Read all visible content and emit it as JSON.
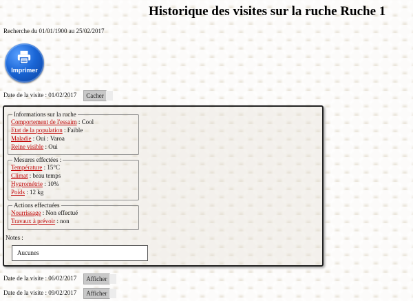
{
  "page": {
    "title": "Historique des visites sur la ruche Ruche 1",
    "search_range": "Recherche du 01/01/1900 au 25/02/2017"
  },
  "print_button": {
    "label": "Imprimer",
    "icon": "printer-icon"
  },
  "visits": [
    {
      "date_text": "Date de la visite : 01/02/2017",
      "button": "Cacher"
    },
    {
      "date_text": "Date de la visite : 06/02/2017",
      "button": "Afficher"
    },
    {
      "date_text": "Date de la visite : 09/02/2017",
      "button": "Afficher"
    }
  ],
  "details": {
    "info": {
      "legend": "Informations sur la ruche",
      "rows": [
        {
          "label": "Comportement de l'essaim",
          "sep": " : ",
          "value": "Cool"
        },
        {
          "label": "Etat de la population",
          "sep": " : ",
          "value": "Faible"
        },
        {
          "label": "Maladie",
          "sep": " : ",
          "value": "Oui : Varoa"
        },
        {
          "label": "Reine visible",
          "sep": " : ",
          "value": "Oui"
        }
      ]
    },
    "measures": {
      "legend": "Mesures effectées :",
      "rows": [
        {
          "label": "Température",
          "sep": " : ",
          "value": "15°C"
        },
        {
          "label": "Climat",
          "sep": " : ",
          "value": "beau temps"
        },
        {
          "label": "Hygrométrie",
          "sep": " : ",
          "value": "10%"
        },
        {
          "label": "Poids",
          "sep": " : ",
          "value": "12 kg"
        }
      ]
    },
    "actions": {
      "legend": "Actions effectuées",
      "rows": [
        {
          "label": "Nourrissage",
          "sep": " : ",
          "value": "Non effectué"
        },
        {
          "label": "Travaux à prévoir",
          "sep": " : ",
          "value": "non"
        }
      ]
    },
    "notes": {
      "label": "Notes :",
      "value": "Aucunes"
    }
  },
  "colors": {
    "label_red": "#c00000",
    "print_blue": "#1a66d6"
  }
}
